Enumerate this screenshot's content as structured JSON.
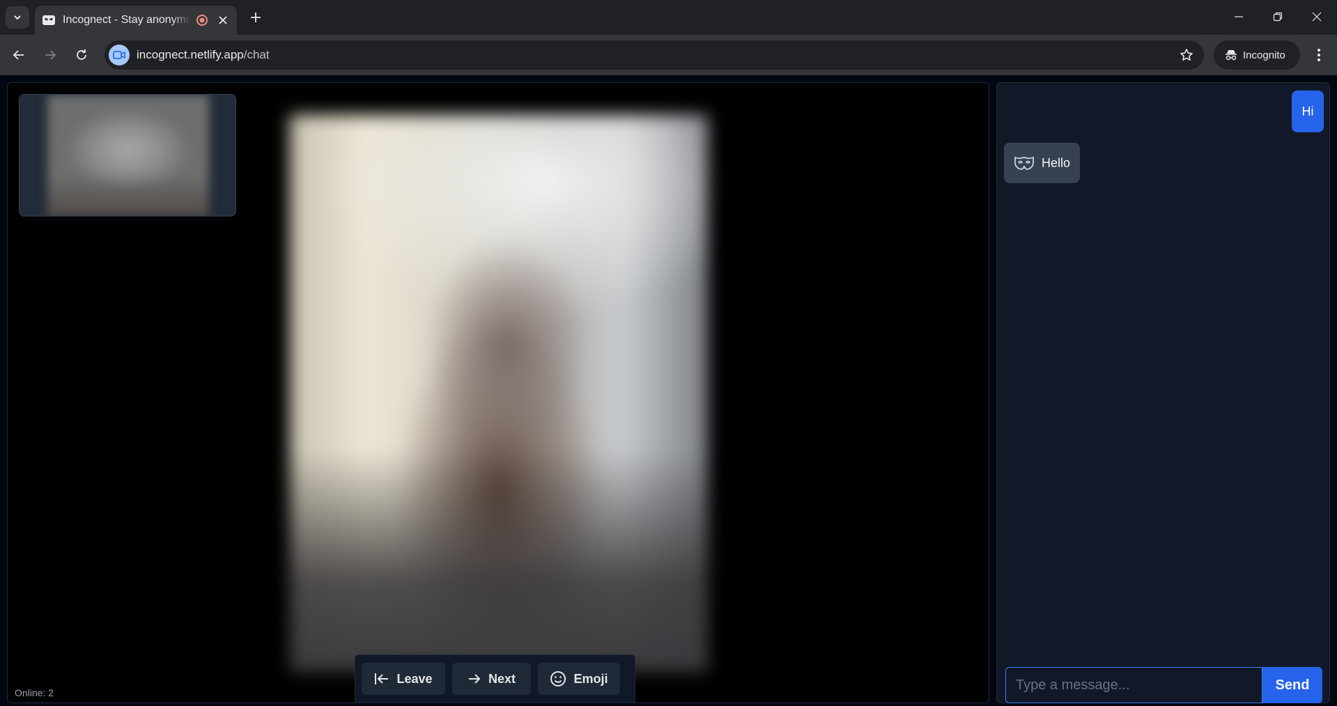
{
  "browser": {
    "tab": {
      "title": "Incognect - Stay anonymous",
      "favicon": "mask-icon",
      "recording_indicator": "record-icon"
    },
    "address_bar": {
      "host": "incognect.netlify.app",
      "path": "/chat",
      "site_icon": "video-camera-icon"
    },
    "profile_label": "Incognito"
  },
  "video": {
    "online_label": "Online: 2"
  },
  "controls": {
    "leave": "Leave",
    "next": "Next",
    "emoji": "Emoji"
  },
  "chat": {
    "messages": [
      {
        "from": "me",
        "text": "Hi"
      },
      {
        "from": "stranger",
        "text": "Hello",
        "avatar": "mask-icon"
      }
    ],
    "input_placeholder": "Type a message...",
    "send_label": "Send"
  },
  "colors": {
    "accent": "#2563eb",
    "panel_bg": "#111827",
    "stranger_bubble": "#374151"
  }
}
